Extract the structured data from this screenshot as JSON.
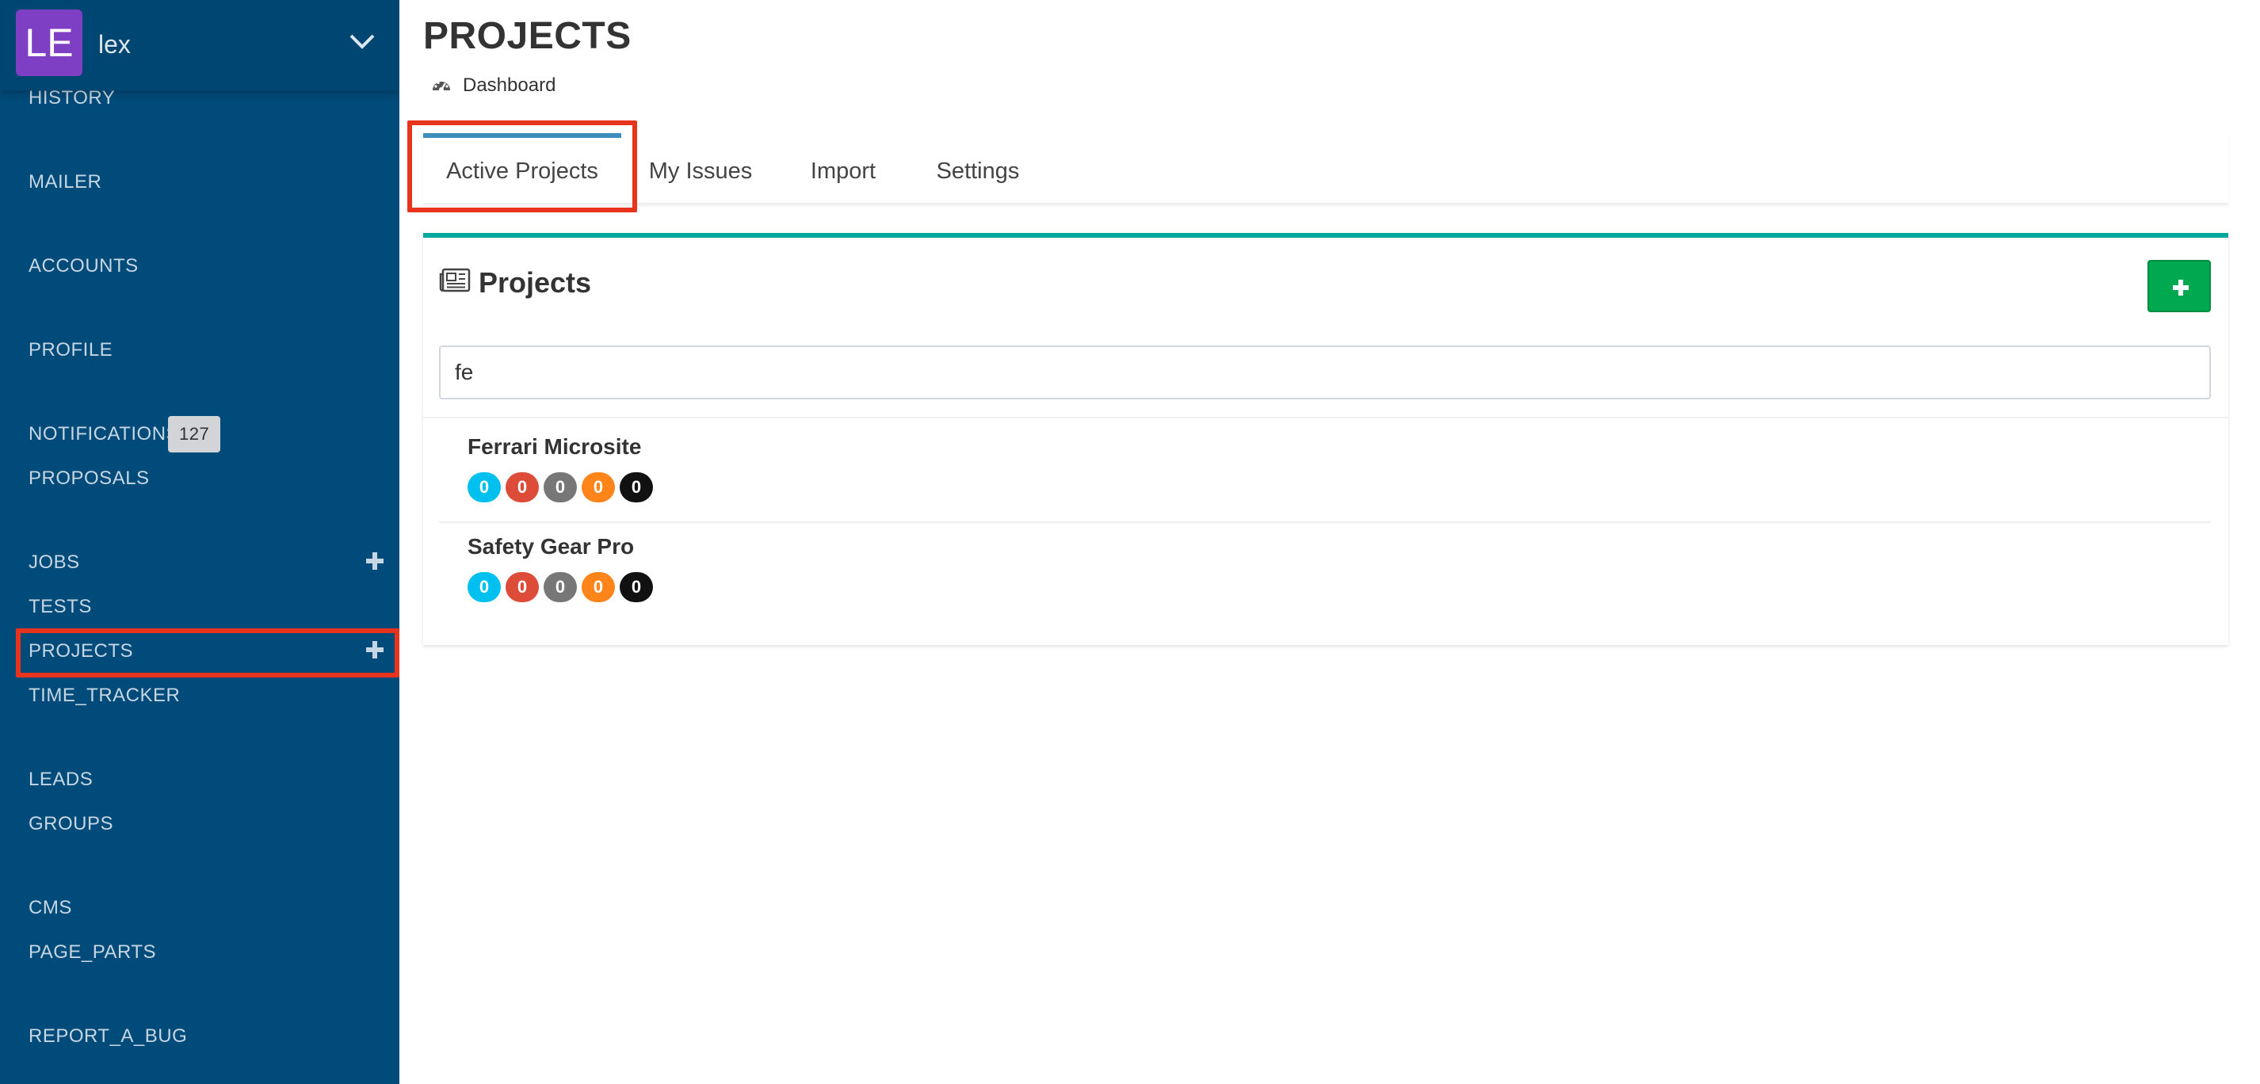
{
  "user": {
    "initials": "LE",
    "name": "lex"
  },
  "sidebar": {
    "items": [
      {
        "label": "HISTORY"
      },
      {
        "label": "MAILER"
      },
      {
        "label": "ACCOUNTS"
      },
      {
        "label": "PROFILE"
      },
      {
        "label": "NOTIFICATIONS",
        "badge": "127"
      },
      {
        "label": "PROPOSALS"
      },
      {
        "label": "JOBS"
      },
      {
        "label": "TESTS"
      },
      {
        "label": "PROJECTS"
      },
      {
        "label": "TIME_TRACKER"
      },
      {
        "label": "LEADS"
      },
      {
        "label": "GROUPS"
      },
      {
        "label": "CMS"
      },
      {
        "label": "PAGE_PARTS"
      },
      {
        "label": "REPORT_A_BUG"
      }
    ]
  },
  "page": {
    "title": "PROJECTS",
    "breadcrumb": "Dashboard"
  },
  "tabs": [
    {
      "label": "Active Projects",
      "active": true
    },
    {
      "label": "My Issues"
    },
    {
      "label": "Import"
    },
    {
      "label": "Settings"
    }
  ],
  "panel": {
    "title": "Projects",
    "search_value": "fe"
  },
  "projects": [
    {
      "name": "Ferrari Microsite",
      "counts": [
        "0",
        "0",
        "0",
        "0",
        "0"
      ]
    },
    {
      "name": "Safety Gear Pro",
      "counts": [
        "0",
        "0",
        "0",
        "0",
        "0"
      ]
    }
  ],
  "colors": {
    "sidebar_bg": "#004b7a",
    "accent_tab": "#3c8dbc",
    "panel_top": "#00a89d",
    "add_button": "#00a84f",
    "highlight": "#e8341c",
    "status": [
      "#00c0ef",
      "#dd4b39",
      "#777777",
      "#ff851b",
      "#111111"
    ]
  },
  "icons": {
    "user_menu": "chevron-down-icon",
    "breadcrumb": "dashboard-icon",
    "panel": "newspaper-icon",
    "add": "plus-icon"
  }
}
